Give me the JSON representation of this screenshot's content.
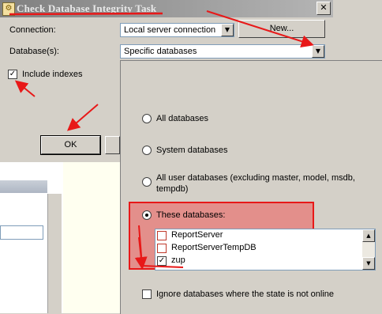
{
  "dialog": {
    "title": "Check Database Integrity Task",
    "close_glyph": "✕",
    "title_icon_glyph": "⚙"
  },
  "connection": {
    "label": "Connection:",
    "value": "Local server connection",
    "new_button": "New..."
  },
  "databases": {
    "label": "Database(s):",
    "value": "Specific databases"
  },
  "include_indexes": {
    "label": "Include indexes",
    "checked": true
  },
  "ok_button": "OK",
  "popup": {
    "options": [
      {
        "label": "All databases",
        "selected": false
      },
      {
        "label": "System databases",
        "selected": false
      },
      {
        "label": "All user databases  (excluding master, model, msdb,",
        "label_line2": "tempdb)",
        "selected": false
      },
      {
        "label": "These databases:",
        "selected": true
      }
    ],
    "database_list": [
      {
        "name": "ReportServer",
        "checked": false
      },
      {
        "name": "ReportServerTempDB",
        "checked": false
      },
      {
        "name": "zup",
        "checked": true
      }
    ],
    "ignore_offline": {
      "label": "Ignore databases where the state is not online",
      "checked": false
    }
  },
  "glyphs": {
    "check": "✓",
    "dropdown_arrow": "▼",
    "scroll_up": "▲",
    "scroll_down": "▼"
  },
  "annotation_color": "#e81818"
}
